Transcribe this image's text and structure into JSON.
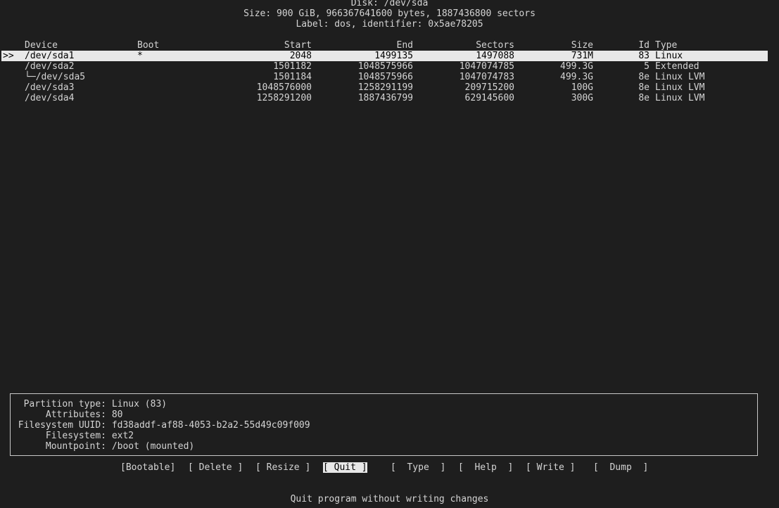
{
  "header": {
    "disk": "Disk: /dev/sda",
    "size": "Size: 900 GiB, 966367641600 bytes, 1887436800 sectors",
    "label": "Label: dos, identifier: 0x5ae78205"
  },
  "table": {
    "columns": {
      "device": "Device",
      "boot": "Boot",
      "start": "Start",
      "end": "End",
      "sectors": "Sectors",
      "size": "Size",
      "id": "Id",
      "type": "Type"
    },
    "cursor": ">>",
    "rows": [
      {
        "device": "/dev/sda1",
        "boot": "*",
        "start": "2048",
        "end": "1499135",
        "sectors": "1497088",
        "size": "731M",
        "id": "83",
        "type": "Linux"
      },
      {
        "device": "/dev/sda2",
        "boot": "",
        "start": "1501182",
        "end": "1048575966",
        "sectors": "1047074785",
        "size": "499.3G",
        "id": "5",
        "type": "Extended"
      },
      {
        "device": "└─/dev/sda5",
        "boot": "",
        "start": "1501184",
        "end": "1048575966",
        "sectors": "1047074783",
        "size": "499.3G",
        "id": "8e",
        "type": "Linux LVM"
      },
      {
        "device": "/dev/sda3",
        "boot": "",
        "start": "1048576000",
        "end": "1258291199",
        "sectors": "209715200",
        "size": "100G",
        "id": "8e",
        "type": "Linux LVM"
      },
      {
        "device": "/dev/sda4",
        "boot": "",
        "start": "1258291200",
        "end": "1887436799",
        "sectors": "629145600",
        "size": "300G",
        "id": "8e",
        "type": "Linux LVM"
      }
    ]
  },
  "info": {
    "partition_type_label": "Partition type:",
    "partition_type_value": "Linux (83)",
    "attributes_label": "Attributes:",
    "attributes_value": "80",
    "uuid_label": "Filesystem UUID:",
    "uuid_value": "fd38addf-af88-4053-b2a2-55d49c09f009",
    "filesystem_label": "Filesystem:",
    "filesystem_value": "ext2",
    "mountpoint_label": "Mountpoint:",
    "mountpoint_value": "/boot (mounted)"
  },
  "menu": {
    "bootable": "[Bootable]",
    "delete": "[ Delete ]",
    "resize": "[ Resize ]",
    "quit_open": "[",
    "quit": " Quit ",
    "quit_close": "]",
    "type": "[  Type  ]",
    "help": "[  Help  ]",
    "write": "[ Write ]",
    "dump": "[  Dump  ]"
  },
  "status": "Quit program without writing changes"
}
